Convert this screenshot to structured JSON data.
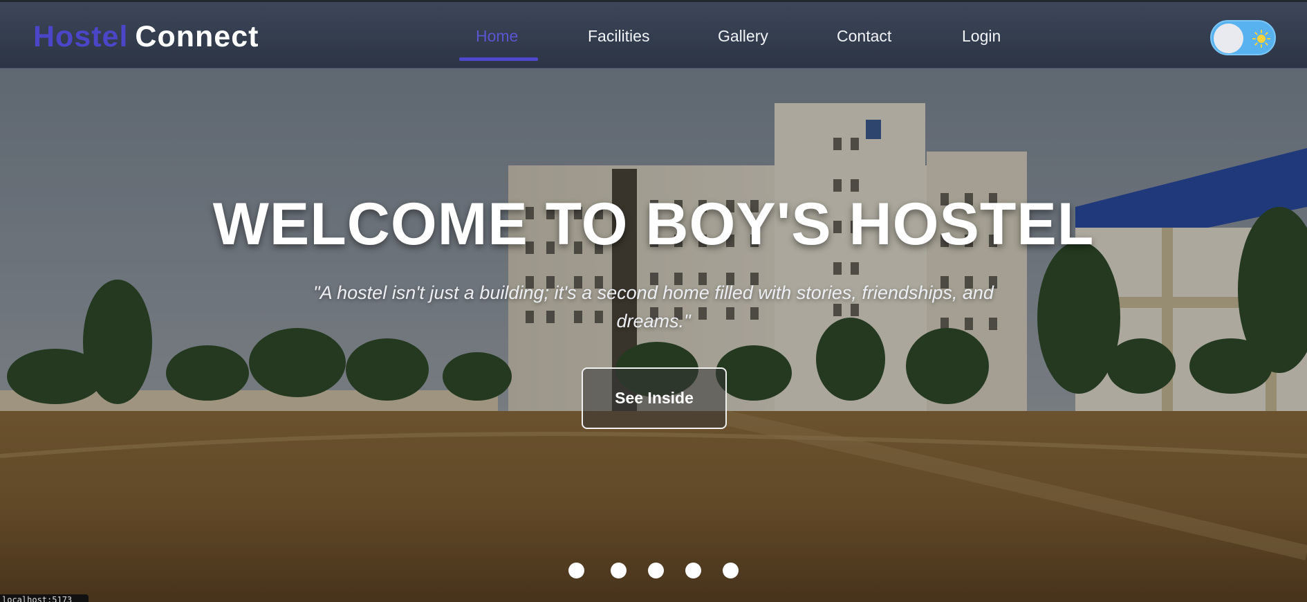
{
  "brand": {
    "part1": "Hostel",
    "part2": "Connect"
  },
  "nav": {
    "items": [
      {
        "label": "Home",
        "active": true
      },
      {
        "label": "Facilities",
        "active": false
      },
      {
        "label": "Gallery",
        "active": false
      },
      {
        "label": "Contact",
        "active": false
      },
      {
        "label": "Login",
        "active": false
      }
    ]
  },
  "theme_toggle": {
    "icon": "sun-icon",
    "state": "light"
  },
  "hero": {
    "title": "WELCOME TO BOY'S HOSTEL",
    "tagline": "\"A hostel isn't just a building; it's a second home filled with stories, friendships, and dreams.\"",
    "cta_label": "See Inside",
    "slides_count": 5
  },
  "status_text": "localhost:5173",
  "colors": {
    "brand_accent": "#4b46c8",
    "navbar": "#353e50",
    "toggle": "#59b2f0"
  }
}
